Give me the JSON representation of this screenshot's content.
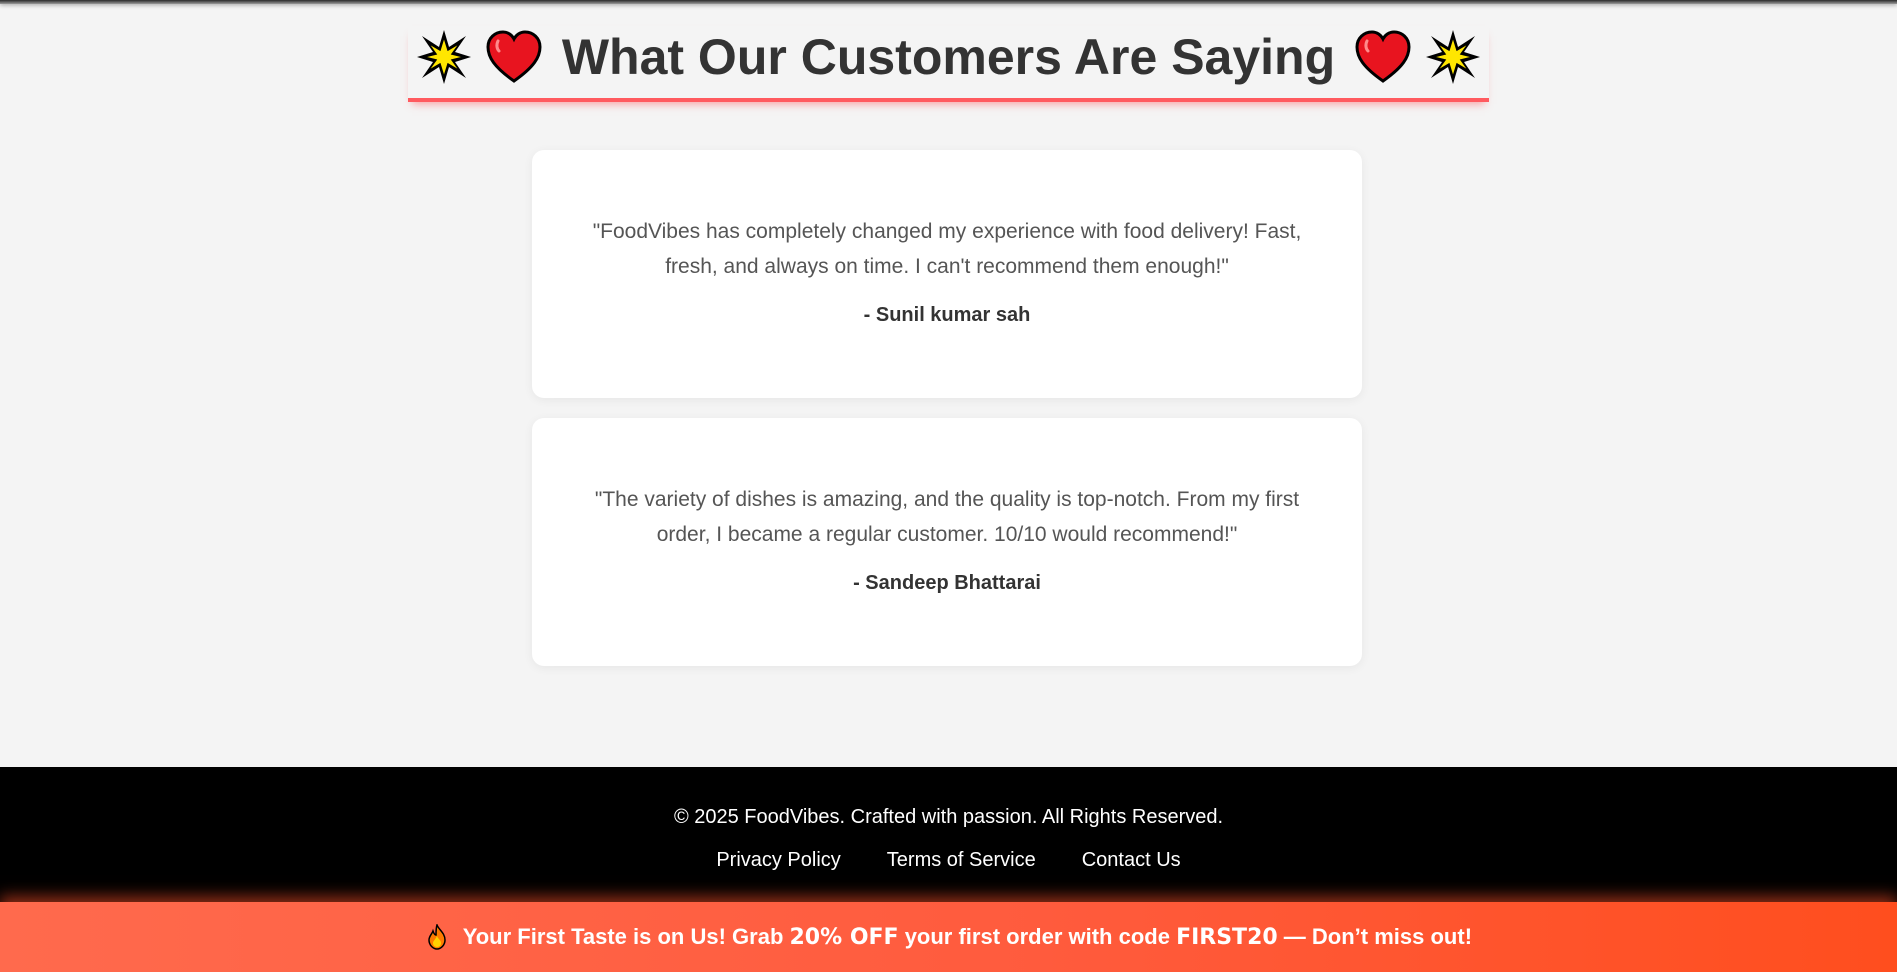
{
  "testimonials_section": {
    "title": "What Our Customers Are Saying",
    "title_icons": [
      "sparkle-icon",
      "heart-icon",
      "heart-icon",
      "sparkle-icon"
    ],
    "accent_color": "#ff5a5f",
    "items": [
      {
        "quote": "\"FoodVibes has completely changed my experience with food delivery! Fast, fresh, and always on time. I can't recommend them enough!\"",
        "author": "- Sunil kumar sah"
      },
      {
        "quote": "\"The variety of dishes is amazing, and the quality is top-notch. From my first order, I became a regular customer. 10/10 would recommend!\"",
        "author": "- Sandeep Bhattarai"
      }
    ]
  },
  "footer": {
    "copyright": "© 2025 FoodVibes. Crafted with passion. All Rights Reserved.",
    "links": [
      "Privacy Policy",
      "Terms of Service",
      "Contact Us"
    ],
    "background": "#000000"
  },
  "promo_banner": {
    "icon": "fire-icon",
    "text_1": " Your First Taste is on Us! Grab ",
    "highlight_1": "20% OFF",
    "text_2": " your first order with code ",
    "highlight_2": "FIRST20",
    "text_3": " — Don’t miss out!",
    "color": "#ff5a3c"
  }
}
